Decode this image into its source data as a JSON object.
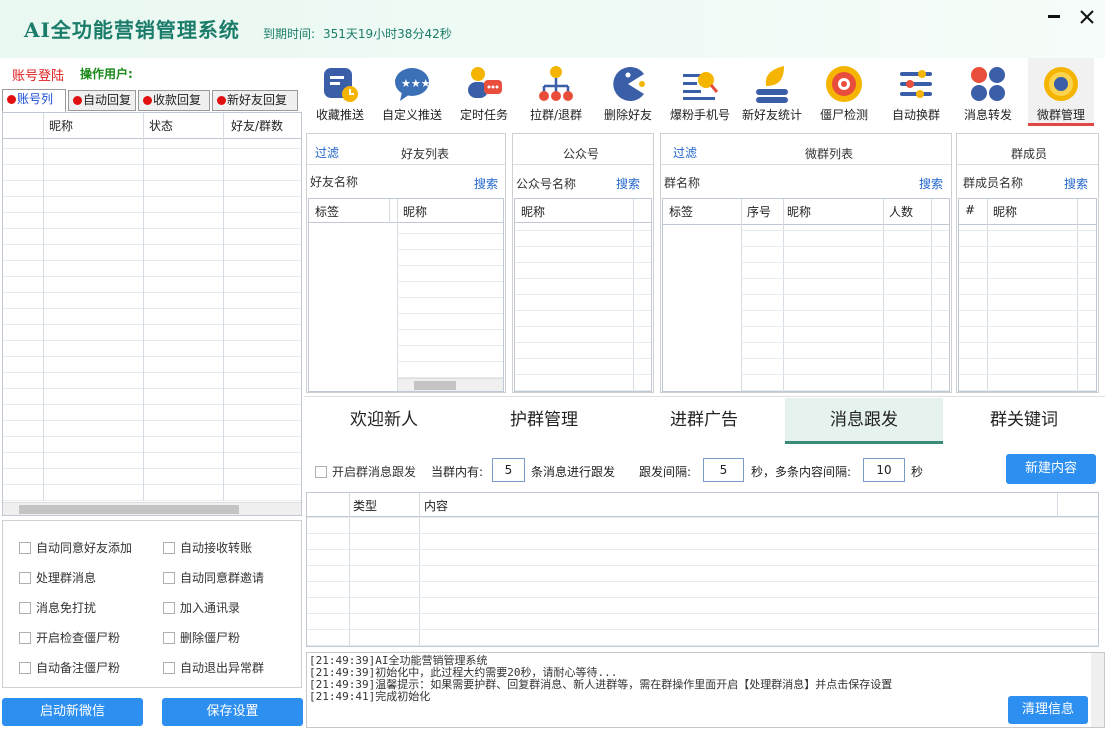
{
  "app": {
    "title": "AI全功能营销管理系统",
    "expire_label": "到期时间:",
    "expire_value": "351天19小时38分42秒",
    "account_login": "账号登陆",
    "operator": "操作用户:"
  },
  "toolbar": [
    {
      "label": "收藏推送",
      "icon": "bookmark-push-icon"
    },
    {
      "label": "自定义推送",
      "icon": "chat-stars-icon"
    },
    {
      "label": "定时任务",
      "icon": "person-chat-icon"
    },
    {
      "label": "拉群/退群",
      "icon": "org-tree-icon"
    },
    {
      "label": "删除好友",
      "icon": "pacman-icon"
    },
    {
      "label": "爆粉手机号",
      "icon": "search-list-icon"
    },
    {
      "label": "新好友统计",
      "icon": "leaf-stack-icon"
    },
    {
      "label": "僵尸检测",
      "icon": "target-icon"
    },
    {
      "label": "自动换群",
      "icon": "sliders-icon"
    },
    {
      "label": "消息转发",
      "icon": "dots-grid-icon"
    },
    {
      "label": "微群管理",
      "icon": "gear-icon"
    }
  ],
  "left_tabs": [
    "账号列",
    "自动回复",
    "收款回复",
    "新好友回复"
  ],
  "account_table": {
    "columns": [
      "昵称",
      "状态",
      "好友/群数"
    ]
  },
  "options": [
    [
      "自动同意好友添加",
      "自动接收转账"
    ],
    [
      "处理群消息",
      "自动同意群邀请"
    ],
    [
      "消息免打扰",
      "加入通讯录"
    ],
    [
      "开启检查僵尸粉",
      "删除僵尸粉"
    ],
    [
      "自动备注僵尸粉",
      "自动退出异常群"
    ]
  ],
  "buttons": {
    "start_wechat": "启动新微信",
    "save_settings": "保存设置",
    "new_content": "新建内容",
    "clear_info": "清理信息"
  },
  "friends_panel": {
    "filter": "过滤",
    "title": "好友列表",
    "search_label": "好友名称",
    "search": "搜索",
    "columns": [
      "标签",
      "昵称"
    ]
  },
  "official_panel": {
    "title": "公众号",
    "search_label": "公众号名称",
    "search": "搜索",
    "columns": [
      "昵称"
    ]
  },
  "groups_panel": {
    "filter": "过滤",
    "title": "微群列表",
    "search_label": "群名称",
    "search": "搜索",
    "columns": [
      "标签",
      "序号",
      "昵称",
      "人数"
    ]
  },
  "members_panel": {
    "title": "群成员",
    "search_label": "群成员名称",
    "search": "搜索",
    "columns": [
      "#",
      "昵称"
    ]
  },
  "sub_tabs": [
    "欢迎新人",
    "护群管理",
    "进群广告",
    "消息跟发",
    "群关键词"
  ],
  "follow": {
    "enable_label": "开启群消息跟发",
    "in_group": "当群内有:",
    "count": "5",
    "count_suffix": "条消息进行跟发",
    "interval_label": "跟发间隔:",
    "interval": "5",
    "interval_suffix": "秒，多条内容间隔:",
    "multi_interval": "10",
    "sec": "秒"
  },
  "content_table": {
    "columns": [
      "类型",
      "内容"
    ]
  },
  "log": [
    "[21:49:39]AI全功能营销管理系统",
    "[21:49:39]初始化中，此过程大约需要20秒，请耐心等待...",
    "[21:49:39]温馨提示：如果需要护群、回复群消息、新人进群等，需在群操作里面开启【处理群消息】并点击保存设置",
    "[21:49:41]完成初始化"
  ],
  "colors": {
    "brand": "#1b7c6a",
    "button": "#2d8ff0",
    "link": "#2266cc",
    "active_tab_line": "#e04848"
  }
}
